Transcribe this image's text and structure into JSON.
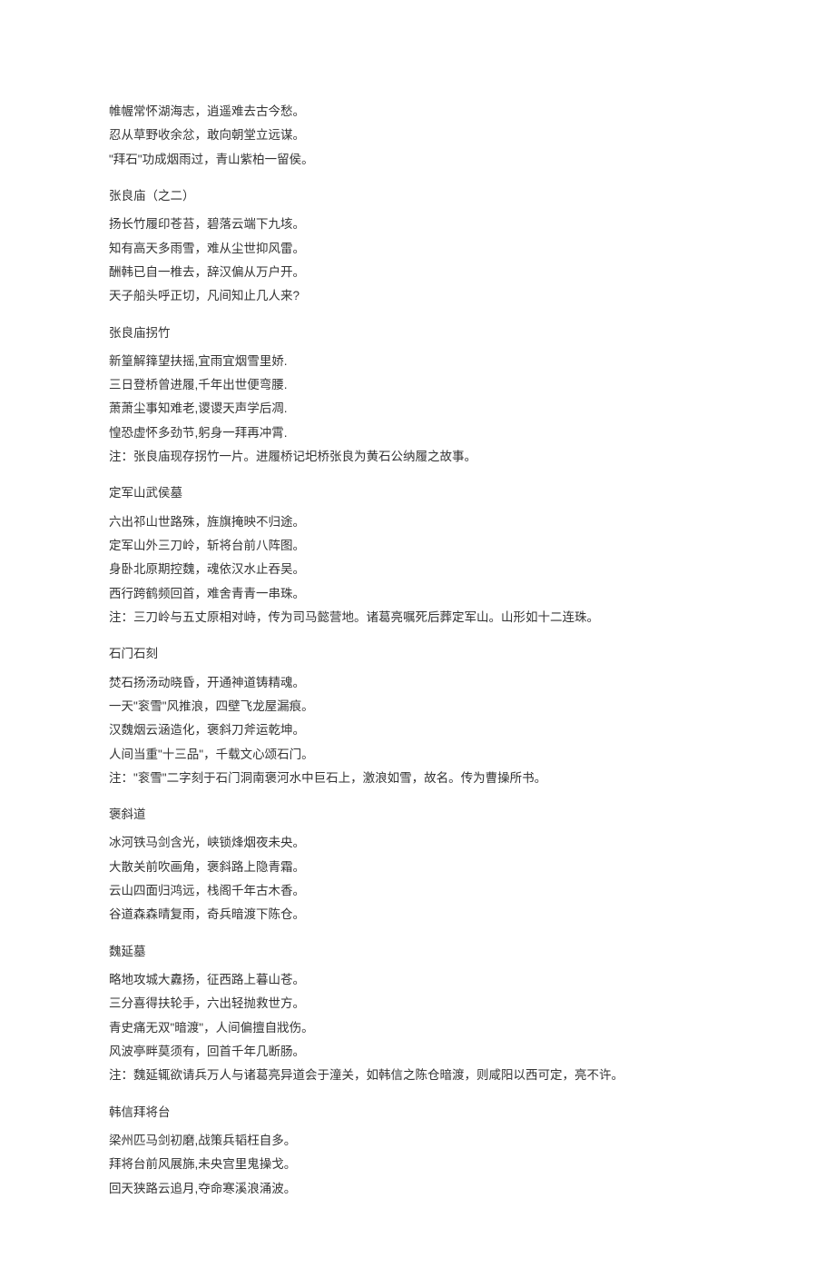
{
  "poems": [
    {
      "title": "",
      "lines": [
        "帷幄常怀湖海志，逍遥难去古今愁。",
        "忍从草野收余忿，敢向朝堂立远谋。",
        "\"拜石\"功成烟雨过，青山紫柏一留侯。"
      ]
    },
    {
      "title": "张良庙（之二）",
      "lines": [
        "扬长竹履印苍苔，碧落云端下九垓。",
        "知有高天多雨雪，难从尘世抑风雷。",
        "酬韩已自一椎去，辞汉偏从万户开。",
        "天子船头呼正切，凡间知止几人来?"
      ]
    },
    {
      "title": "张良庙拐竹",
      "lines": [
        "新篁解箨望扶摇,宜雨宜烟雪里娇.",
        "三日登桥曾进履,千年出世便弯腰.",
        "萧萧尘事知难老,谡谡天声学后凋.",
        "惶恐虚怀多劲节,躬身一拜再冲霄.",
        "注：张良庙现存拐竹一片。进履桥记圯桥张良为黄石公纳履之故事。"
      ]
    },
    {
      "title": "定军山武侯墓",
      "lines": [
        "六出祁山世路殊，旌旗掩映不归途。",
        "定军山外三刀岭，斩将台前八阵图。",
        "身卧北原期控魏，魂依汉水止吞吴。",
        "西行跨鹤频回首，难舍青青一串珠。",
        "注：三刀岭与五丈原相对峙，传为司马懿营地。诸葛亮嘱死后葬定军山。山形如十二连珠。"
      ]
    },
    {
      "title": "石门石刻",
      "lines": [
        "焚石扬汤动晓昏，开通神道铸精魂。",
        "一天\"衮雪\"风推浪，四壁飞龙屋漏痕。",
        "汉魏烟云涵造化，褒斜刀斧运乾坤。",
        "人间当重\"十三品\"，千载文心颂石门。",
        "注：\"衮雪\"二字刻于石门洞南褒河水中巨石上，激浪如雪，故名。传为曹操所书。"
      ]
    },
    {
      "title": "褒斜道",
      "lines": [
        "冰河铁马剑含光，峡锁烽烟夜未央。",
        "大散关前吹画角，褒斜路上隐青霜。",
        "云山四面归鸿远，栈阁千年古木香。",
        "谷道森森晴复雨，奇兵暗渡下陈仓。"
      ]
    },
    {
      "title": "魏延墓",
      "lines": [
        "略地攻城大纛扬，征西路上暮山苍。",
        "三分喜得扶轮手，六出轻抛救世方。",
        "青史痛无双\"暗渡\"，人间偏擅自戕伤。",
        "风波亭畔莫须有，回首千年几断肠。",
        "注：魏延辄欲请兵万人与诸葛亮异道会于潼关，如韩信之陈仓暗渡，则咸阳以西可定，亮不许。"
      ]
    },
    {
      "title": "韩信拜将台",
      "lines": [
        "梁州匹马剑初磨,战策兵韬枉自多。",
        "拜将台前风展旆,未央宫里鬼操戈。",
        "回天狭路云追月,夺命寒溪浪涌波。"
      ]
    }
  ]
}
